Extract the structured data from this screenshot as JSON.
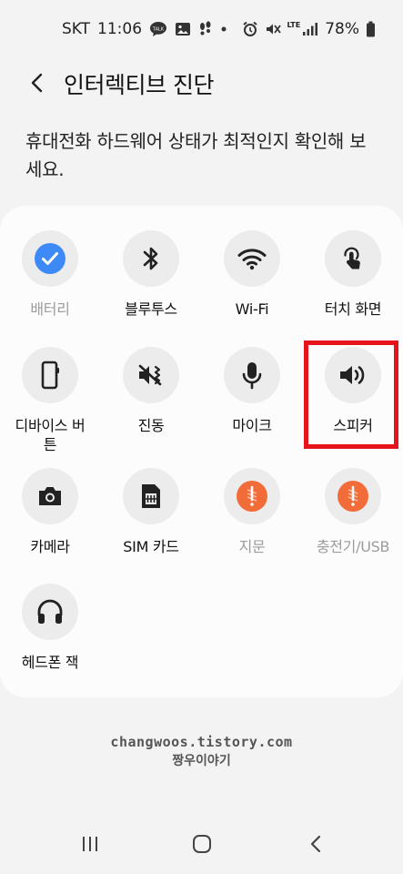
{
  "status_bar": {
    "carrier": "SKT",
    "time": "11:06",
    "lte": "LTE",
    "battery": "78%"
  },
  "header": {
    "title": "인터렉티브 진단"
  },
  "description": "휴대전화 하드웨어 상태가 최적인지 확인해 보세요.",
  "tests": [
    {
      "label": "배터리",
      "icon": "check-circle-icon",
      "disabled": true
    },
    {
      "label": "블루투스",
      "icon": "bluetooth-icon",
      "disabled": false
    },
    {
      "label": "Wi-Fi",
      "icon": "wifi-icon",
      "disabled": false
    },
    {
      "label": "터치 화면",
      "icon": "touch-icon",
      "disabled": false
    },
    {
      "label": "디바이스 버튼",
      "icon": "device-button-icon",
      "disabled": false
    },
    {
      "label": "진동",
      "icon": "vibration-icon",
      "disabled": false
    },
    {
      "label": "마이크",
      "icon": "microphone-icon",
      "disabled": false
    },
    {
      "label": "스피커",
      "icon": "speaker-icon",
      "disabled": false
    },
    {
      "label": "카메라",
      "icon": "camera-icon",
      "disabled": false
    },
    {
      "label": "SIM 카드",
      "icon": "sim-card-icon",
      "disabled": false
    },
    {
      "label": "지문",
      "icon": "fingerprint-unavailable-icon",
      "disabled": true
    },
    {
      "label": "충전기/USB",
      "icon": "charger-unavailable-icon",
      "disabled": true
    },
    {
      "label": "헤드폰 잭",
      "icon": "headphone-icon",
      "disabled": false
    }
  ],
  "watermark": {
    "line1": "changwoos.tistory.com",
    "line2": "짱우이야기"
  },
  "colors": {
    "highlight": "#e8141c",
    "check_blue": "#3d8af7",
    "unavailable_orange": "#f26c3a"
  }
}
